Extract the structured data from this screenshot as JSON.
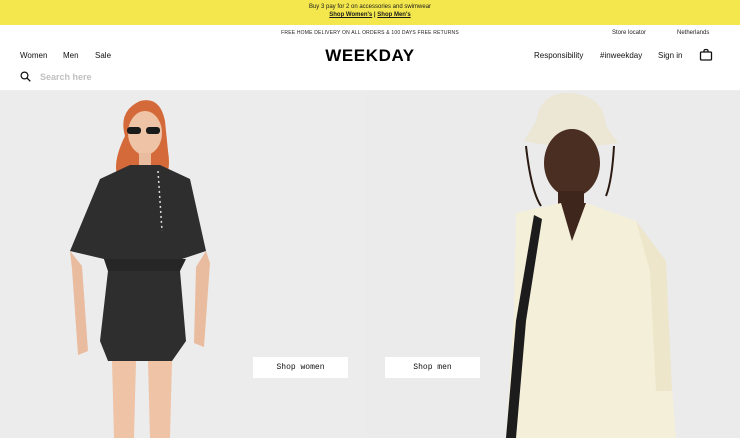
{
  "promo": {
    "line1": "Buy 3 pay for 2 on accessories and swimwear",
    "shop_womens": "Shop Women's",
    "separator": "|",
    "shop_mens": "Shop Men's",
    "background": "#f3e74d"
  },
  "info_bar": {
    "delivery": "FREE HOME DELIVERY ON ALL ORDERS & 100 DAYS FREE RETURNS",
    "store_locator": "Store locator",
    "country": "Netherlands"
  },
  "header": {
    "nav": [
      "Women",
      "Men",
      "Sale"
    ],
    "logo": "WEEKDAY",
    "right_links": [
      "Responsibility",
      "#inweekday",
      "Sign in"
    ],
    "bag_icon": "shopping-bag-icon"
  },
  "search": {
    "icon": "search-icon",
    "placeholder": "Search here",
    "value": ""
  },
  "hero": {
    "women": {
      "cta": "Shop women"
    },
    "men": {
      "cta": "Shop men"
    }
  }
}
